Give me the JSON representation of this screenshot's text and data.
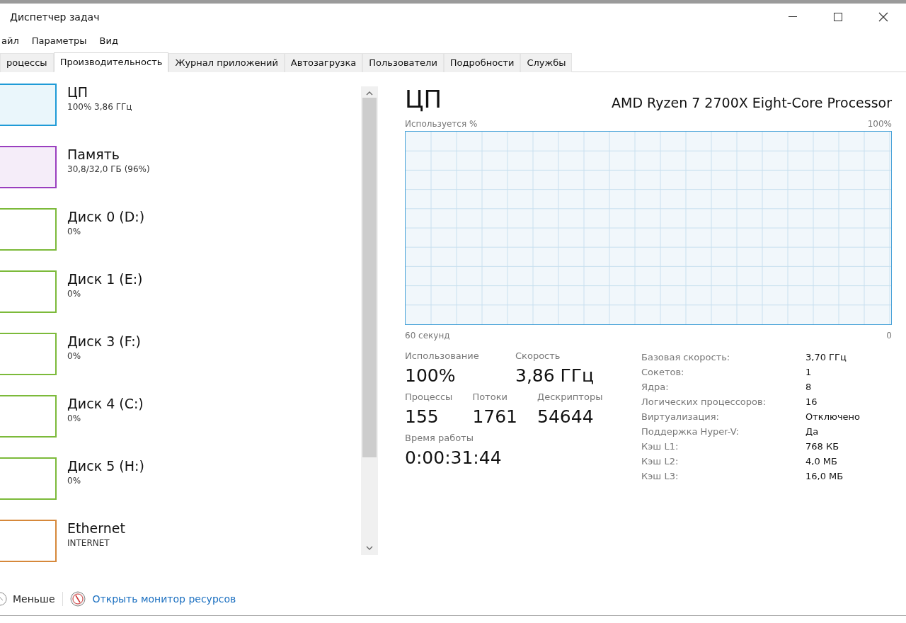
{
  "window": {
    "title": "Диспетчер задач"
  },
  "menu": [
    "айл",
    "Параметры",
    "Вид"
  ],
  "tabs": [
    {
      "label": "роцессы",
      "selected": false
    },
    {
      "label": "Производительность",
      "selected": true
    },
    {
      "label": "Журнал приложений",
      "selected": false
    },
    {
      "label": "Автозагрузка",
      "selected": false
    },
    {
      "label": "Пользователи",
      "selected": false
    },
    {
      "label": "Подробности",
      "selected": false
    },
    {
      "label": "Службы",
      "selected": false
    }
  ],
  "sidebar": {
    "items": [
      {
        "title": "ЦП",
        "subtitle": "100% 3,86 ГГц",
        "color": "#1f9bd7",
        "kind": "filled"
      },
      {
        "title": "Память",
        "subtitle": "30,8/32,0 ГБ (96%)",
        "color": "#9a3fbf",
        "kind": "filled"
      },
      {
        "title": "Диск 0 (D:)",
        "subtitle": "0%",
        "color": "#7cba3a",
        "kind": "empty"
      },
      {
        "title": "Диск 1 (E:)",
        "subtitle": "0%",
        "color": "#7cba3a",
        "kind": "empty"
      },
      {
        "title": "Диск 3 (F:)",
        "subtitle": "0%",
        "color": "#7cba3a",
        "kind": "empty"
      },
      {
        "title": "Диск 4 (C:)",
        "subtitle": "0%",
        "color": "#7cba3a",
        "kind": "empty"
      },
      {
        "title": "Диск 5 (H:)",
        "subtitle": "0%",
        "color": "#7cba3a",
        "kind": "empty"
      },
      {
        "title": "Ethernet",
        "subtitle": "INTERNET",
        "color": "#d6883a",
        "kind": "empty"
      }
    ]
  },
  "detail": {
    "title": "ЦП",
    "device": "AMD Ryzen 7 2700X Eight-Core Processor",
    "graph_label": "Используется %",
    "graph_max": "100%",
    "graph_time": "60 секунд",
    "graph_min": "0",
    "stats": [
      {
        "label": "Использование",
        "value": "100%"
      },
      {
        "label": "Скорость",
        "value": "3,86 ГГц"
      }
    ],
    "counts": [
      {
        "label": "Процессы",
        "value": "155"
      },
      {
        "label": "Потоки",
        "value": "1761"
      },
      {
        "label": "Дескрипторы",
        "value": "54644"
      }
    ],
    "uptime": {
      "label": "Время работы",
      "value": "0:00:31:44"
    },
    "specs": [
      {
        "label": "Базовая скорость:",
        "value": "3,70 ГГц"
      },
      {
        "label": "Сокетов:",
        "value": "1"
      },
      {
        "label": "Ядра:",
        "value": "8"
      },
      {
        "label": "Логических процессоров:",
        "value": "16"
      },
      {
        "label": "Виртуализация:",
        "value": "Отключено"
      },
      {
        "label": "Поддержка Hyper-V:",
        "value": "Да"
      },
      {
        "label": "Кэш L1:",
        "value": "768 КБ"
      },
      {
        "label": "Кэш L2:",
        "value": "4,0 МБ"
      },
      {
        "label": "Кэш L3:",
        "value": "16,0 МБ"
      }
    ]
  },
  "footer": {
    "less": "Меньше",
    "link": "Открыть монитор ресурсов"
  }
}
